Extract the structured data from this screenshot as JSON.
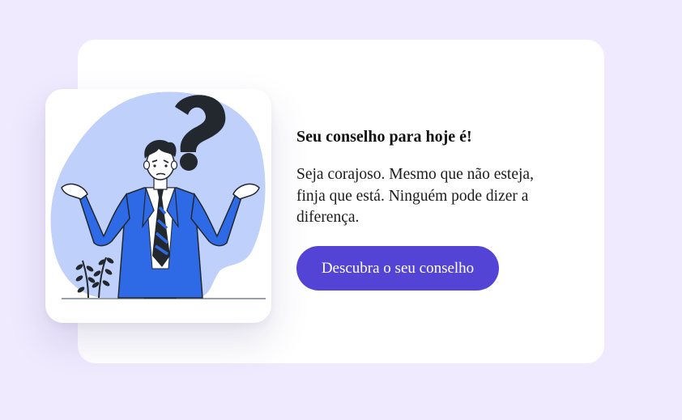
{
  "advice_card": {
    "title": "Seu conselho para hoje é!",
    "advice_text": "Seja corajoso. Mesmo que não esteja, finja que está. Ninguém pode dizer a diferença.",
    "button_label": "Descubra o seu conselho"
  },
  "illustration": {
    "icon": "confused-man-question-mark-icon"
  },
  "colors": {
    "page_background": "#efeafe",
    "card_background": "#ffffff",
    "button_background": "#5444d6",
    "blob": "#bfd1fa",
    "suit": "#2e6ae6",
    "dark": "#23272e"
  }
}
